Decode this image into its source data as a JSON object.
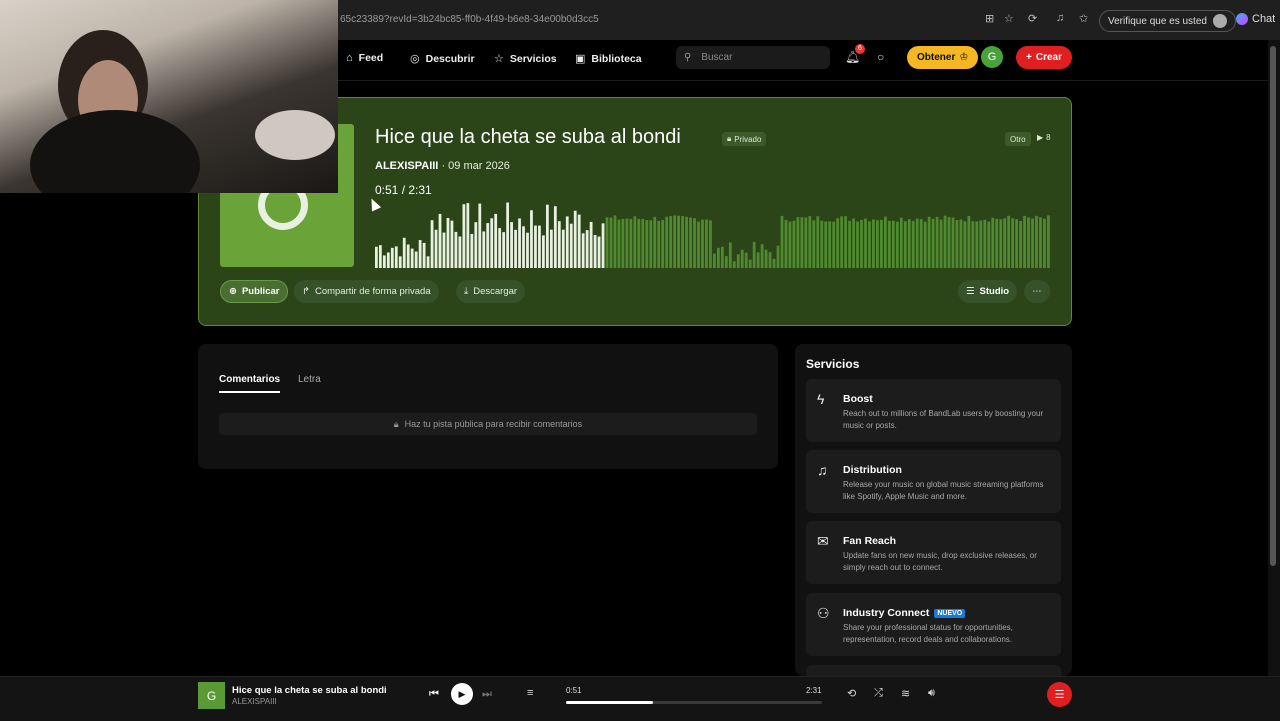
{
  "browser": {
    "url": "65c23389?revId=3b24bc85-ff0b-4f49-b6e8-34e00b0d3cc5",
    "verify_label": "Verifique que es usted",
    "chat_label": "Chat"
  },
  "nav": {
    "items": [
      {
        "label": "Feed",
        "icon": "home-icon"
      },
      {
        "label": "Descubrir",
        "icon": "compass-icon"
      },
      {
        "label": "Servicios",
        "icon": "star-icon"
      },
      {
        "label": "Biblioteca",
        "icon": "library-icon"
      }
    ],
    "search_placeholder": "Buscar",
    "notification_count": "6",
    "obtener_label": "Obtener",
    "avatar_initial": "G",
    "crear_label": "Crear",
    "colors": {
      "accent": "#e02020",
      "obtener": "#f5b823"
    }
  },
  "track": {
    "title": "Hice que la cheta se suba al bondi",
    "privacy": "Privado",
    "genre": "Otro",
    "plays": "8",
    "artist": "ALEXISPAIII",
    "date": "· 09 mar 2026",
    "current_time": "0:51",
    "separator": " / ",
    "duration": "2:31",
    "played_fraction": 0.338,
    "actions": {
      "publicar": "Publicar",
      "compartir": "Compartir de forma privada",
      "descargar": "Descargar",
      "studio": "Studio"
    },
    "colors": {
      "card_bg": "#2b4518",
      "cover": "#6aa337",
      "wave_played": "#e8f0e0",
      "wave_unplayed": "#4f8a2f"
    }
  },
  "comments": {
    "tabs": [
      "Comentarios",
      "Letra"
    ],
    "notice": "Haz tu pista pública para recibir comentarios"
  },
  "services": {
    "heading": "Servicios",
    "items": [
      {
        "title": "Boost",
        "icon": "bolt-icon",
        "desc": "Reach out to millions of BandLab users by boosting your music or posts."
      },
      {
        "title": "Distribution",
        "icon": "globe-icon",
        "desc": "Release your music on global music streaming platforms like Spotify, Apple Music and more."
      },
      {
        "title": "Fan Reach",
        "icon": "mail-icon",
        "desc": "Update fans on new music, drop exclusive releases, or simply reach out to connect."
      },
      {
        "title": "Industry Connect",
        "icon": "people-icon",
        "badge": "NUEVO",
        "desc": "Share your professional status for opportunities, representation, record deals and collaborations."
      }
    ]
  },
  "player": {
    "thumb_initial": "G",
    "title": "Hice que la cheta se suba al bondi",
    "artist": "ALEXISPAIII",
    "current": "0:51",
    "duration": "2:31",
    "progress_fraction": 0.338
  }
}
